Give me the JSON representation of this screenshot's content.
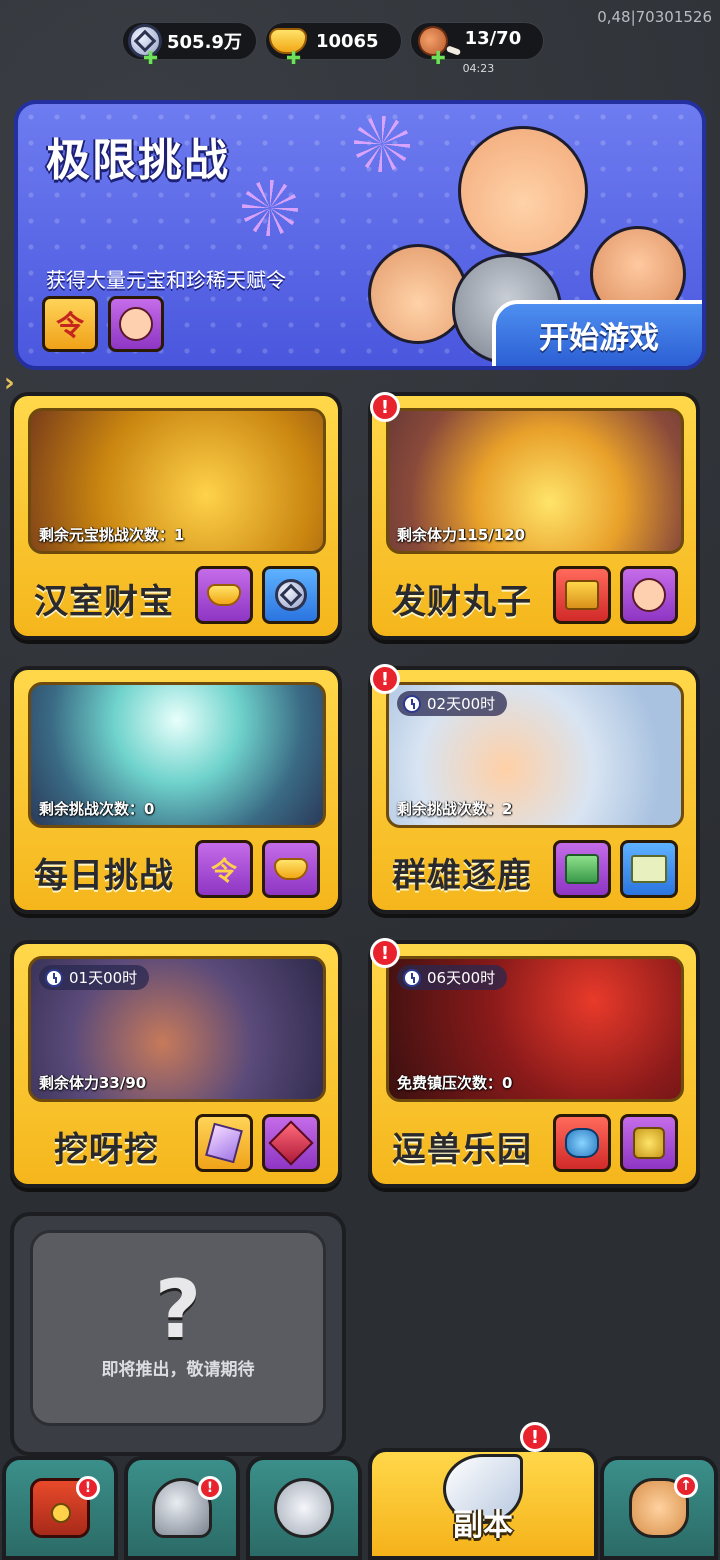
{
  "status": {
    "debug_text": "0,48|70301526"
  },
  "resources": [
    {
      "icon": "silver-coin-icon",
      "value": "505.9万",
      "sub": ""
    },
    {
      "icon": "gold-ingot-icon",
      "value": "10065",
      "sub": ""
    },
    {
      "icon": "meat-stamina-icon",
      "value": "13/70",
      "sub": "04:23"
    }
  ],
  "banner": {
    "title": "极限挑战",
    "description": "获得大量元宝和珍稀天赋令",
    "start_label": "开始游戏"
  },
  "cards": [
    {
      "title": "汉室财宝",
      "info": "剩余元宝挑战次数：1",
      "timer": "",
      "alert": false,
      "rewards": [
        "gold-ingot-icon",
        "silver-coin-icon"
      ]
    },
    {
      "title": "发财丸子",
      "info": "剩余体力115/120",
      "timer": "",
      "alert": true,
      "rewards": [
        "treasure-chest-icon",
        "hero-portrait-icon"
      ]
    },
    {
      "title": "每日挑战",
      "info": "剩余挑战次数：0",
      "timer": "",
      "alert": false,
      "rewards": [
        "talent-token-icon",
        "gold-ingot-icon"
      ]
    },
    {
      "title": "群雄逐鹿",
      "info": "剩余挑战次数：2",
      "timer": "02天00时",
      "alert": true,
      "rewards": [
        "jade-seal-icon",
        "map-scroll-icon"
      ]
    },
    {
      "title": "挖呀挖",
      "info": "剩余体力33/90",
      "timer": "01天00时",
      "alert": false,
      "rewards": [
        "crystal-icon",
        "ruby-gem-icon"
      ]
    },
    {
      "title": "逗兽乐园",
      "info": "免费镇压次数：0",
      "timer": "06天00时",
      "alert": true,
      "rewards": [
        "dragon-pet-icon",
        "beast-badge-icon"
      ]
    }
  ],
  "coming_soon": {
    "symbol": "?",
    "text": "即将推出，敬请期待"
  },
  "nav": {
    "active_label": "副本"
  },
  "colors": {
    "card_gold": "#f5b61c",
    "banner_blue": "#4a57de",
    "alert_red": "#e8232e",
    "tab_teal": "#2b6b67"
  }
}
